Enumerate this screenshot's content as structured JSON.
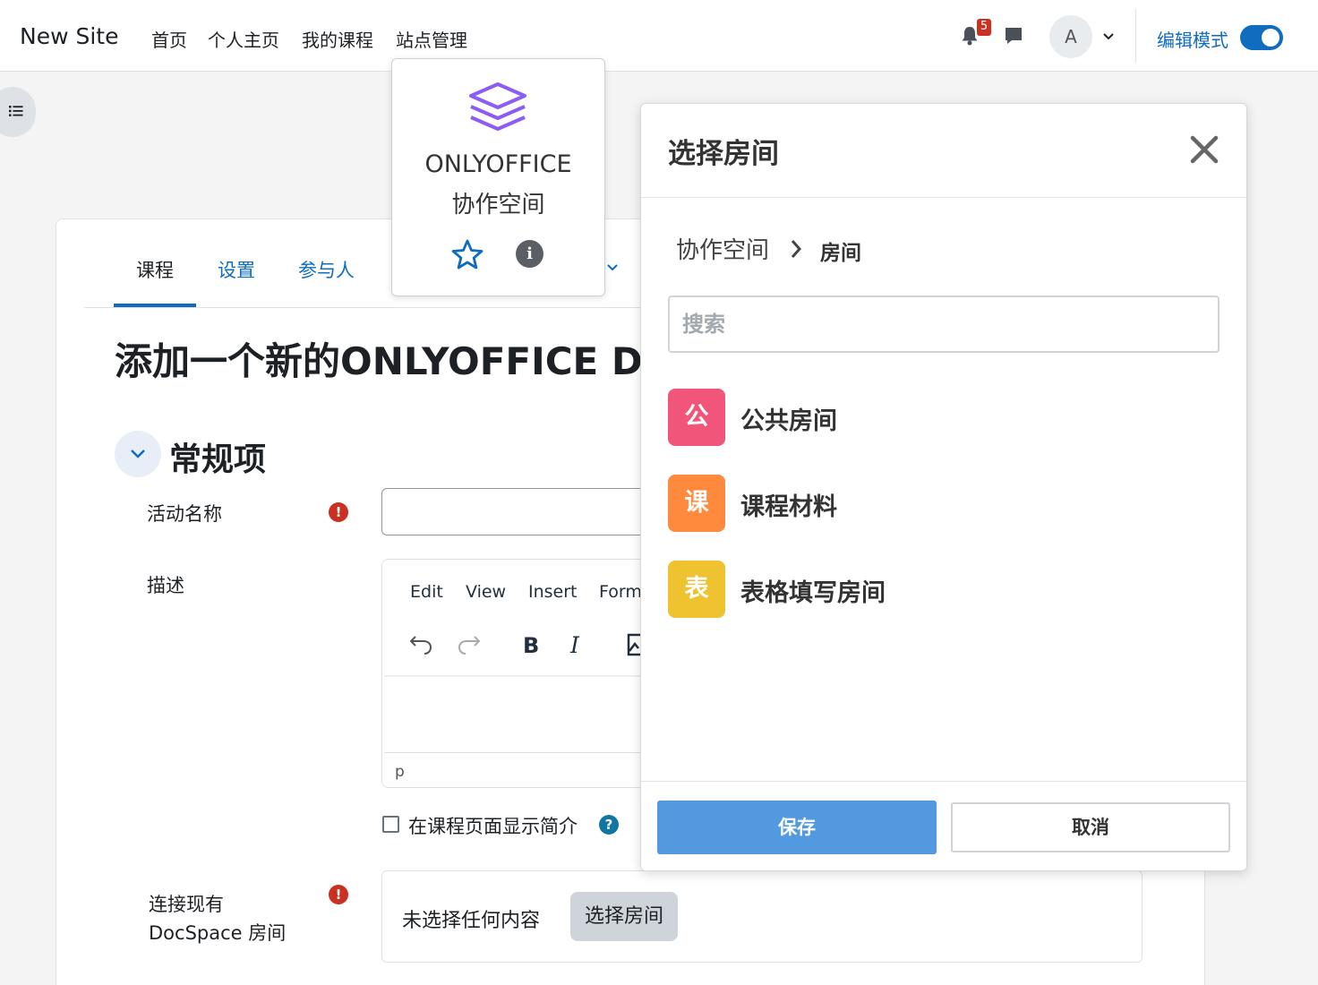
{
  "navbar": {
    "site_name": "New Site",
    "items": [
      "首页",
      "个人主页",
      "我的课程",
      "站点管理"
    ],
    "notification_count": "5",
    "user_initial": "A",
    "edit_mode_label": "编辑模式",
    "edit_mode_on": true,
    "accent_color": "#0f6cbf"
  },
  "course": {
    "tabs": [
      "课程",
      "设置",
      "参与人"
    ],
    "active_tab": "课程",
    "page_title": "添加一个新的ONLYOFFICE Dc",
    "section_title": "常规项",
    "activity_name_label": "活动名称",
    "description_label": "描述",
    "editor_menu": [
      "Edit",
      "View",
      "Insert",
      "Form"
    ],
    "editor_path": "p",
    "show_description_label": "在课程页面显示简介",
    "connect_room_label_line1": "连接现有",
    "connect_room_label_line2": "DocSpace 房间",
    "nothing_selected": "未选择任何内容",
    "choose_room_button": "选择房间"
  },
  "onlyoffice_popover": {
    "name": "ONLYOFFICE",
    "subtitle": "协作空间",
    "icons": [
      "layers-logo-icon",
      "star-icon",
      "info-icon"
    ],
    "logo_color": "#8b5cf6"
  },
  "modal": {
    "title": "选择房间",
    "breadcrumb_root": "协作空间",
    "breadcrumb_current": "房间",
    "search_placeholder": "搜索",
    "rooms": [
      {
        "icon_char": "公",
        "name": "公共房间",
        "color": "#f2557a"
      },
      {
        "icon_char": "课",
        "name": "课程材料",
        "color": "#ff8a3d"
      },
      {
        "icon_char": "表",
        "name": "表格填写房间",
        "color": "#eec32f"
      }
    ],
    "save_label": "保存",
    "cancel_label": "取消",
    "save_color": "#5299e0"
  }
}
